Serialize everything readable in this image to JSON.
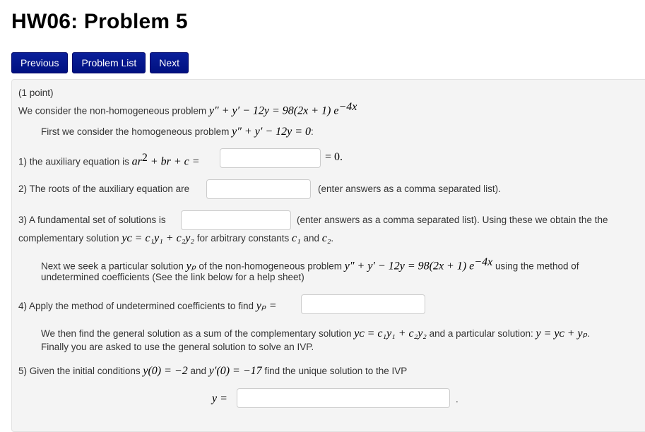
{
  "page": {
    "title": "HW06: Problem 5"
  },
  "nav": {
    "previous": "Previous",
    "problem_list": "Problem List",
    "next": "Next"
  },
  "problem": {
    "points": "(1 point)",
    "intro_text": "We consider the non-homogeneous problem",
    "intro_eq": "y″ + y′ − 12y = 98(2x + 1) e",
    "intro_exp": "−4x",
    "homog_text": "First we consider the homogeneous problem",
    "homog_eq": "y″ + y′ − 12y = 0",
    "homog_colon": ":",
    "q1_text": "1) the auxiliary equation is",
    "q1_eq_a": "ar",
    "q1_eq_sup": "2",
    "q1_eq_b": " + br + c =",
    "q1_after": "= 0.",
    "q1_value": "",
    "q2_text": "2) The roots of the auxiliary equation are",
    "q2_value": "",
    "q2_after": "(enter answers as a comma separated list).",
    "q3_text": "3) A fundamental set of solutions is",
    "q3_value": "",
    "q3_after": "(enter answers as a comma separated list). Using these we obtain the the",
    "q3_line2_text": "complementary solution",
    "q3_line2_eq": "yᴄ = c₁y₁ + c₂y₂",
    "q3_line2_mid": "for arbitrary constants",
    "q3_line2_c1": "c₁",
    "q3_line2_and": "and",
    "q3_line2_c2": "c₂",
    "q3_line2_end": ".",
    "part_text1": "Next we seek a particular solution",
    "part_yp": "yₚ",
    "part_text2": "of the non-homogeneous problem",
    "part_eq": "y″ + y′ − 12y = 98(2x + 1) e",
    "part_exp": "−4x",
    "part_text3": "using the method of",
    "part_line2": "undetermined coefficients (See the link below for a help sheet)",
    "q4_text": "4) Apply the method of undetermined coefficients to find",
    "q4_eq": "yₚ =",
    "q4_value": "",
    "gen_text1": "We then find the general solution as a sum of the complementary solution",
    "gen_eq1": "yᴄ = c₁y₁ + c₂y₂",
    "gen_text2": "and a particular solution:",
    "gen_eq2": "y = yᴄ + yₚ",
    "gen_end": ".",
    "gen_line2": "Finally you are asked to use the general solution to solve an IVP.",
    "q5_text1": "5) Given the initial conditions",
    "q5_eq1": "y(0) = −2",
    "q5_and": "and",
    "q5_eq2": "y′(0) = −17",
    "q5_text2": "find the unique solution to the IVP",
    "q5_label": "y =",
    "q5_value": "",
    "q5_after": "."
  }
}
